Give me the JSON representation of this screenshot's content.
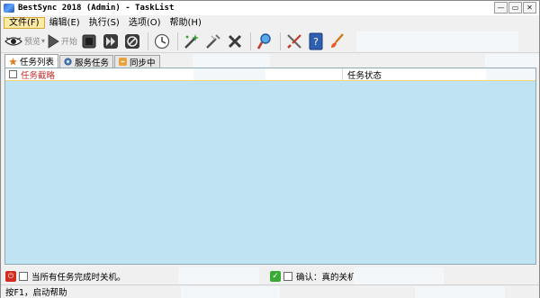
{
  "window": {
    "title": "BestSync 2018 (Admin) - TaskList",
    "controls": {
      "minimize": "—",
      "restore": "▭",
      "close": "✕"
    }
  },
  "menu": {
    "items": [
      {
        "label": "文件(F)"
      },
      {
        "label": "编辑(E)"
      },
      {
        "label": "执行(S)"
      },
      {
        "label": "选项(O)"
      },
      {
        "label": "帮助(H)"
      }
    ]
  },
  "toolbar": {
    "preview_label": "预览",
    "start_label": "开始",
    "icons": [
      "eye-icon",
      "play-icon",
      "stop-icon",
      "fast-forward-icon",
      "cancel-icon",
      "schedule-clock-icon",
      "new-task-wand-icon",
      "edit-task-icon",
      "delete-task-icon",
      "search-icon",
      "tools-icon",
      "help-book-icon",
      "brush-icon"
    ]
  },
  "tabs": [
    {
      "label": "任务列表",
      "icon": "star-icon",
      "selected": true
    },
    {
      "label": "服务任务",
      "icon": "gear-icon",
      "selected": false
    },
    {
      "label": "同步中",
      "icon": "sync-icon",
      "selected": false
    }
  ],
  "grid": {
    "columns": [
      {
        "label": "任务截略"
      },
      {
        "label": "任务状态"
      }
    ],
    "background": "#bfe3f3"
  },
  "options": {
    "shutdown_label": "当所有任务完成时关机。",
    "confirm_label": "确认：真的关机吗"
  },
  "status": {
    "text": "按F1，启动帮助"
  },
  "colors": {
    "accent": "#fbe9a6",
    "grid_bg": "#bfe3f3",
    "header_text_red": "#c03030",
    "power_red": "#d42b1f",
    "ok_green": "#3aaa35"
  }
}
